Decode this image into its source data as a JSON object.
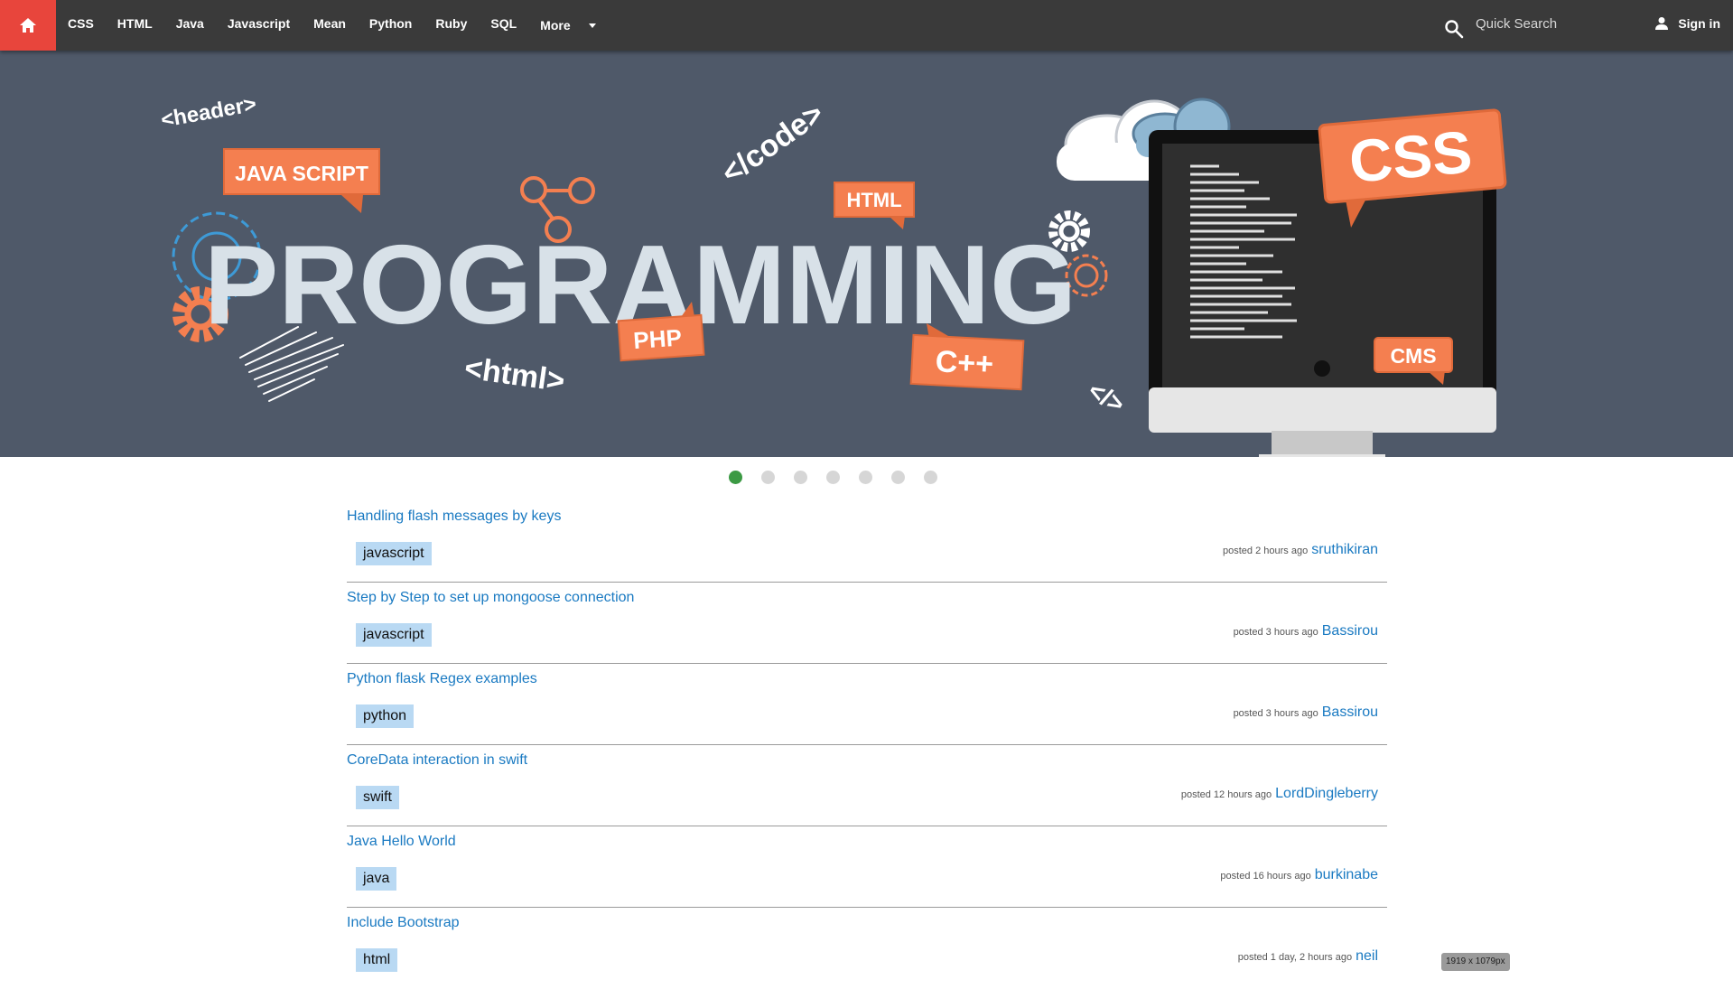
{
  "navbar": {
    "home_icon": "home-icon",
    "items": [
      "CSS",
      "HTML",
      "Java",
      "Javascript",
      "Mean",
      "Python",
      "Ruby",
      "SQL"
    ],
    "more_label": "More",
    "search_placeholder": "Quick Search",
    "search_icon": "search-icon",
    "user_icon": "user-icon",
    "signin_label": "Sign in",
    "accent_color": "#e8453c",
    "bar_color": "#3a3a3a"
  },
  "hero": {
    "background": "#4f5969",
    "accent": "#f47f50",
    "title": "PROGRAMMING",
    "bubbles": {
      "javascript": "JAVA SCRIPT",
      "html": "HTML",
      "php": "PHP",
      "cpp": "C++",
      "css": "CSS",
      "cms": "CMS"
    },
    "tags": {
      "header": "<header>",
      "code": "</code>",
      "html": "<html>",
      "close": "</>"
    }
  },
  "carousel": {
    "slide_count": 7,
    "active_index": 0
  },
  "posts": [
    {
      "title": "Handling flash messages by keys",
      "tag": "javascript",
      "time": "posted 2 hours ago",
      "author": "sruthikiran"
    },
    {
      "title": "Step by Step to set up mongoose connection",
      "tag": "javascript",
      "time": "posted 3 hours ago",
      "author": "Bassirou"
    },
    {
      "title": "Python flask Regex examples",
      "tag": "python",
      "time": "posted 3 hours ago",
      "author": "Bassirou"
    },
    {
      "title": "CoreData interaction in swift",
      "tag": "swift",
      "time": "posted 12 hours ago",
      "author": "LordDingleberry"
    },
    {
      "title": "Java Hello World",
      "tag": "java",
      "time": "posted 16 hours ago",
      "author": "burkinabe"
    },
    {
      "title": "Include Bootstrap",
      "tag": "html",
      "time": "posted 1 day, 2 hours ago",
      "author": "neil"
    }
  ],
  "size_badge": "1919 x 1079px"
}
